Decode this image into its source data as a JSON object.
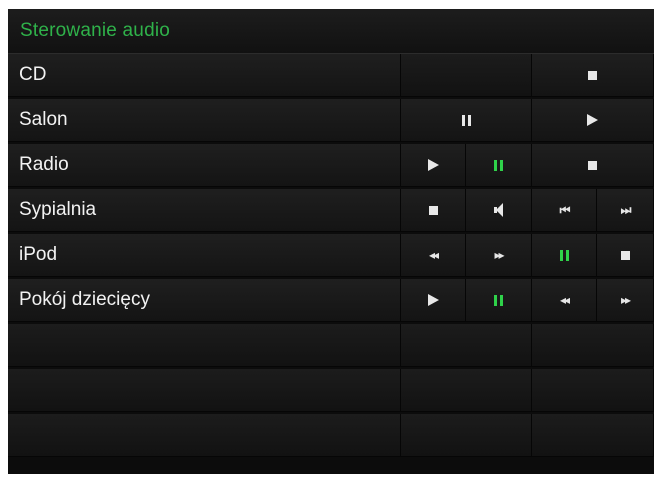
{
  "header": {
    "title": "Sterowanie audio"
  },
  "colors": {
    "accent": "#2fb24a",
    "background": "#0c0c0c",
    "text": "#f2f2f2"
  },
  "rows": [
    {
      "name": "CD",
      "controls": [
        "",
        "stop"
      ]
    },
    {
      "name": "Salon",
      "controls": [
        "pause",
        "play"
      ]
    },
    {
      "name": "Radio",
      "controls": [
        "play",
        "pause-active",
        "stop"
      ]
    },
    {
      "name": "Sypialnia",
      "controls": [
        "stop",
        "mute",
        "previous",
        "next"
      ]
    },
    {
      "name": "iPod",
      "controls": [
        "rewind",
        "fast-forward",
        "pause-active",
        "stop"
      ]
    },
    {
      "name": "Pokój dziecięcy",
      "controls": [
        "play",
        "pause-active",
        "rewind",
        "fast-forward"
      ]
    },
    {
      "name": "",
      "controls": []
    },
    {
      "name": "",
      "controls": []
    },
    {
      "name": "",
      "controls": []
    }
  ],
  "glyphs": {
    "rewind": "◂◂",
    "fast_forward": "▸▸",
    "previous": "⏮",
    "next": "⏭"
  }
}
